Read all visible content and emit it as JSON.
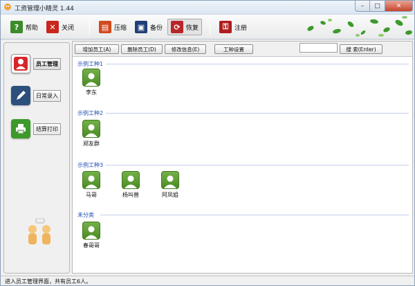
{
  "window": {
    "title": "工资管理小精灵 1.44"
  },
  "toolbar": {
    "help": "帮助",
    "close": "关闭",
    "compress": "压缩",
    "backup": "备份",
    "restore": "恢复",
    "register": "注册"
  },
  "sidebar": {
    "items": [
      {
        "label": "员工管理"
      },
      {
        "label": "日常录入"
      },
      {
        "label": "结算打印"
      }
    ]
  },
  "actions": {
    "add_employee": "增加员工(A)",
    "delete_employee": "删除员工(D)",
    "edit_info": "修改信息(E)",
    "job_settings": "工种设置",
    "search_button": "搜 索(Enter)",
    "search_value": ""
  },
  "groups": [
    {
      "title": "示例工种1",
      "employees": [
        "李东"
      ]
    },
    {
      "title": "示例工种2",
      "employees": [
        "郑友群"
      ]
    },
    {
      "title": "示例工种3",
      "employees": [
        "马哥",
        "杨叫兽",
        "阿凤姐"
      ]
    },
    {
      "title": "未分类",
      "employees": [
        "春哥哥"
      ]
    }
  ],
  "status": {
    "text": "进入员工管理界面，共有员工6人。"
  },
  "colors": {
    "group_title": "#1e4fb3",
    "employee_icon": "#5a9a2e"
  }
}
